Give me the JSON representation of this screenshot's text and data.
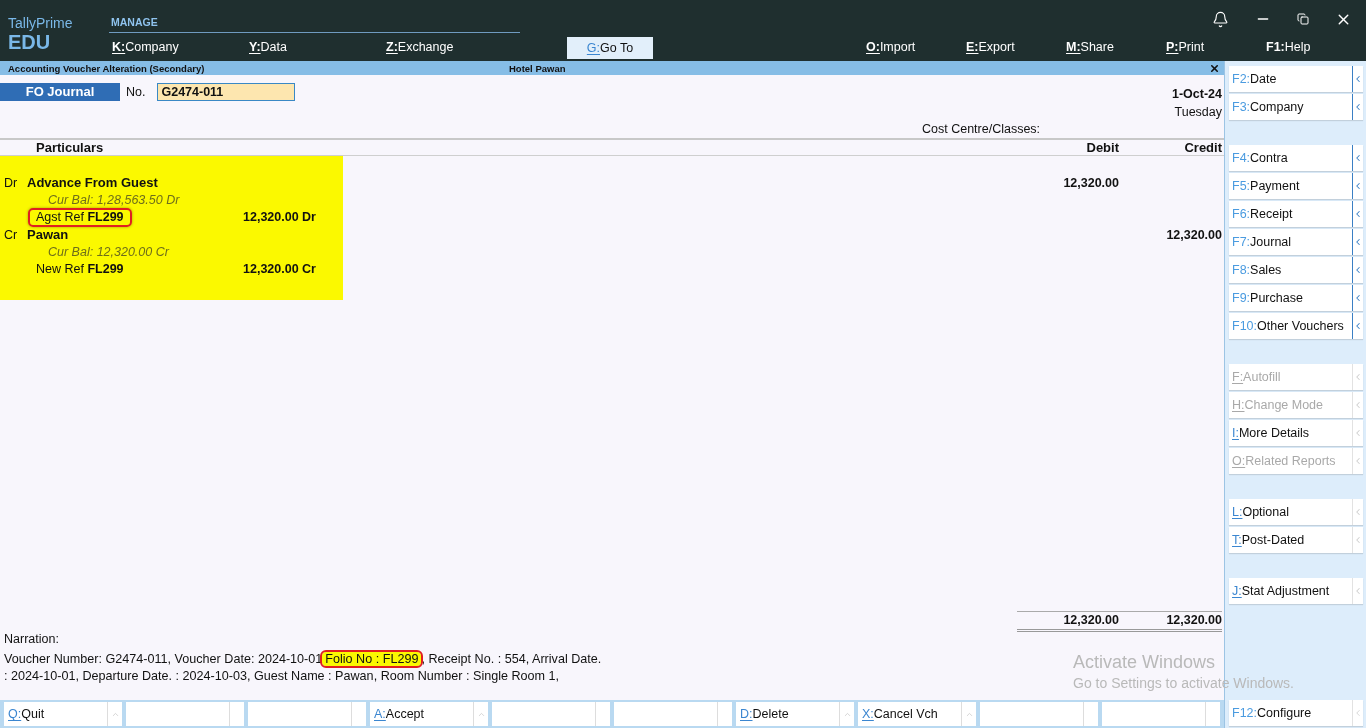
{
  "brand": {
    "product": "TallyPrime",
    "edition": "EDU"
  },
  "top_menu": {
    "heading": "MANAGE",
    "manage_items": [
      {
        "key": "K:",
        "label": "Company"
      },
      {
        "key": "Y:",
        "label": "Data"
      },
      {
        "key": "Z:",
        "label": "Exchange"
      }
    ],
    "goto": {
      "key": "G:",
      "label": "Go To",
      "selected": true
    },
    "actions": [
      {
        "key": "O:",
        "label": "Import",
        "kind": "letter"
      },
      {
        "key": "E:",
        "label": "Export",
        "kind": "letter"
      },
      {
        "key": "M:",
        "label": "Share",
        "kind": "letter"
      },
      {
        "key": "P:",
        "label": "Print",
        "kind": "letter"
      },
      {
        "key": "F1:",
        "label": "Help",
        "kind": "fkey"
      }
    ]
  },
  "title_bar": {
    "title": "Accounting Voucher Alteration (Secondary)",
    "company": "Hotel Pawan"
  },
  "voucher": {
    "type": "FO Journal",
    "number_label": "No.",
    "number": "G2474-011",
    "date": "1-Oct-24",
    "day": "Tuesday",
    "cost_centre_label": "Cost Centre/Classes:"
  },
  "columns": {
    "particulars": "Particulars",
    "debit": "Debit",
    "credit": "Credit"
  },
  "entries": [
    {
      "side": "Dr",
      "ledger": "Advance From Guest",
      "cur_bal_label": "Cur Bal:",
      "cur_bal": "1,28,563.50 Dr",
      "debit": "12,320.00",
      "refs": [
        {
          "type": "Agst Ref",
          "name": "FL299",
          "amount": "12,320.00",
          "side": "Dr",
          "highlighted": true
        }
      ]
    },
    {
      "side": "Cr",
      "ledger": "Pawan",
      "cur_bal_label": "Cur Bal:",
      "cur_bal": "12,320.00 Cr",
      "credit": "12,320.00",
      "refs": [
        {
          "type": "New Ref",
          "name": "FL299",
          "amount": "12,320.00",
          "side": "Cr",
          "highlighted": false
        }
      ]
    }
  ],
  "narration": {
    "label": "Narration:",
    "parts": [
      {
        "text": "Voucher Number: G2474-011, Voucher Date: 2024-10-01",
        "highlighted": false
      },
      {
        "text": "Folio No : FL299",
        "highlighted": true
      },
      {
        "text": ", Receipt No. : 554, Arrival Date. : 2024-10-01, Departure Date. : 2024-10-03, Guest Name : Pawan, Room Number : Single Room 1,",
        "highlighted": false
      }
    ]
  },
  "totals": {
    "debit": "12,320.00",
    "credit": "12,320.00"
  },
  "sidebar": [
    [
      {
        "key": "F2:",
        "label": "Date",
        "kind": "fkey",
        "disabled": false
      },
      {
        "key": "F3:",
        "label": "Company",
        "kind": "fkey",
        "disabled": false
      }
    ],
    [
      {
        "key": "F4:",
        "label": "Contra",
        "kind": "fkey",
        "disabled": false
      },
      {
        "key": "F5:",
        "label": "Payment",
        "kind": "fkey",
        "disabled": false
      },
      {
        "key": "F6:",
        "label": "Receipt",
        "kind": "fkey",
        "disabled": false
      },
      {
        "key": "F7:",
        "label": "Journal",
        "kind": "fkey",
        "disabled": false
      },
      {
        "key": "F8:",
        "label": "Sales",
        "kind": "fkey",
        "disabled": false
      },
      {
        "key": "F9:",
        "label": "Purchase",
        "kind": "fkey",
        "disabled": false
      },
      {
        "key": "F10:",
        "label": "Other Vouchers",
        "kind": "fkey",
        "disabled": false
      }
    ],
    [
      {
        "key": "F:",
        "label": "Autofill",
        "kind": "letter",
        "disabled": true
      },
      {
        "key": "H:",
        "label": "Change Mode",
        "kind": "letter",
        "disabled": true
      },
      {
        "key": "I:",
        "label": "More Details",
        "kind": "letter",
        "disabled": false
      },
      {
        "key": "O:",
        "label": "Related Reports",
        "kind": "letter",
        "disabled": true
      }
    ],
    [
      {
        "key": "L:",
        "label": "Optional",
        "kind": "letter",
        "disabled": false
      },
      {
        "key": "T:",
        "label": "Post-Dated",
        "kind": "letter",
        "disabled": false
      }
    ],
    [
      {
        "key": "J:",
        "label": "Stat Adjustment",
        "kind": "letter",
        "disabled": false
      }
    ]
  ],
  "bottom_bar": [
    {
      "kind": "action",
      "key": "Q:",
      "label": "Quit"
    },
    {
      "kind": "blank"
    },
    {
      "kind": "blank"
    },
    {
      "kind": "action",
      "key": "A:",
      "label": "Accept"
    },
    {
      "kind": "blank"
    },
    {
      "kind": "blank"
    },
    {
      "kind": "action",
      "key": "D:",
      "label": "Delete"
    },
    {
      "kind": "action",
      "key": "X:",
      "label": "Cancel Vch"
    },
    {
      "kind": "blank"
    },
    {
      "kind": "blank"
    }
  ],
  "configure": {
    "key": "F12:",
    "label": "Configure",
    "kind": "fkey"
  },
  "os_notice": {
    "title": "Activate Windows",
    "subtitle": "Go to Settings to activate Windows."
  }
}
